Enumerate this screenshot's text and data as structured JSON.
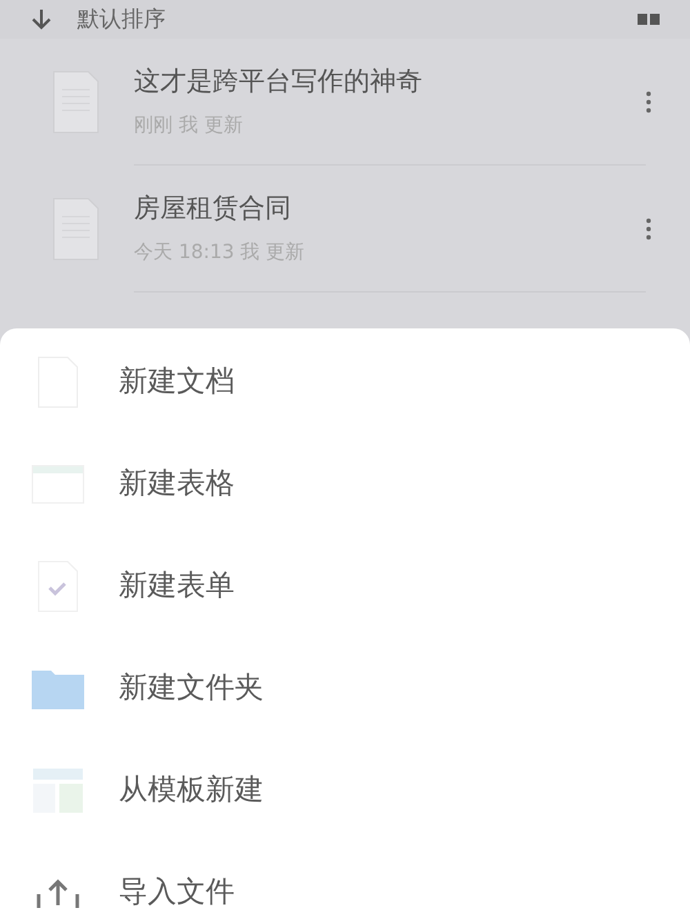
{
  "sort_bar": {
    "label": "默认排序"
  },
  "files": [
    {
      "title": "这才是跨平台写作的神奇",
      "meta": "刚刚 我 更新"
    },
    {
      "title": "房屋租赁合同",
      "meta": "今天 18:13 我 更新"
    }
  ],
  "create_menu": [
    {
      "kind": "doc",
      "label": "新建文档"
    },
    {
      "kind": "sheet",
      "label": "新建表格"
    },
    {
      "kind": "form",
      "label": "新建表单"
    },
    {
      "kind": "folder",
      "label": "新建文件夹"
    },
    {
      "kind": "template",
      "label": "从模板新建"
    },
    {
      "kind": "import",
      "label": "导入文件"
    }
  ]
}
